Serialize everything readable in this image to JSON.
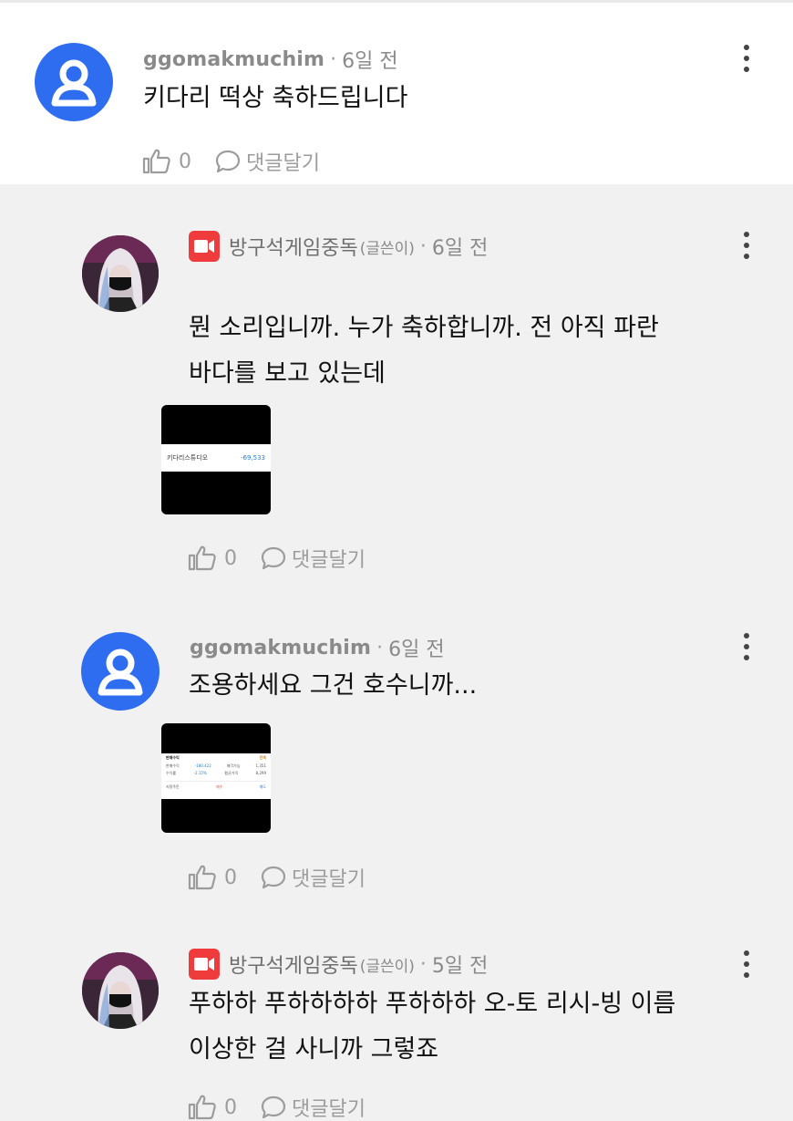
{
  "comments": [
    {
      "author": "ggomakmuchim",
      "time": "6일 전",
      "lines": [
        "키다리 떡상 축하드립니다"
      ],
      "likes": "0",
      "reply_label": "댓글달기",
      "avatar": "default-user-icon"
    }
  ],
  "replies": [
    {
      "author": "방구석게임중독",
      "badge_label": "(글쓴이)",
      "time": "6일 전",
      "lines": [
        "뭔 소리입니까. 누가 축하합니까. 전 아직 파란",
        "바다를 보고 있는데"
      ],
      "attachment": {
        "name": "키다리스튜디오",
        "value": "-69,533"
      },
      "likes": "0",
      "reply_label": "댓글달기",
      "avatar": "profile-photo"
    },
    {
      "author": "ggomakmuchim",
      "time": "6일 전",
      "lines": [
        "조용하세요 그건 호수니까..."
      ],
      "attachment": {
        "title": "판매수익",
        "dropdown": "전체",
        "rows": [
          [
            "판매수익",
            "-180,422",
            "매각가능",
            "1,351"
          ],
          [
            "수익률",
            "-2.15%",
            "평균가격",
            "8,299"
          ]
        ],
        "buttons": [
          "지정주문",
          "매수",
          "매도"
        ]
      },
      "likes": "0",
      "reply_label": "댓글달기",
      "avatar": "default-user-icon"
    },
    {
      "author": "방구석게임중독",
      "badge_label": "(글쓴이)",
      "time": "5일 전",
      "lines": [
        "푸하하 푸하하하하 푸하하하 오-토 리시-빙 이름",
        "이상한 걸 사니까 그렇죠"
      ],
      "likes": "0",
      "reply_label": "댓글달기",
      "avatar": "profile-photo"
    }
  ],
  "colors": {
    "accent_blue": "#2f6df0",
    "badge_red": "#ef3b3b",
    "muted_text": "#8a8a8a",
    "reply_bg": "#f1f1f1"
  }
}
